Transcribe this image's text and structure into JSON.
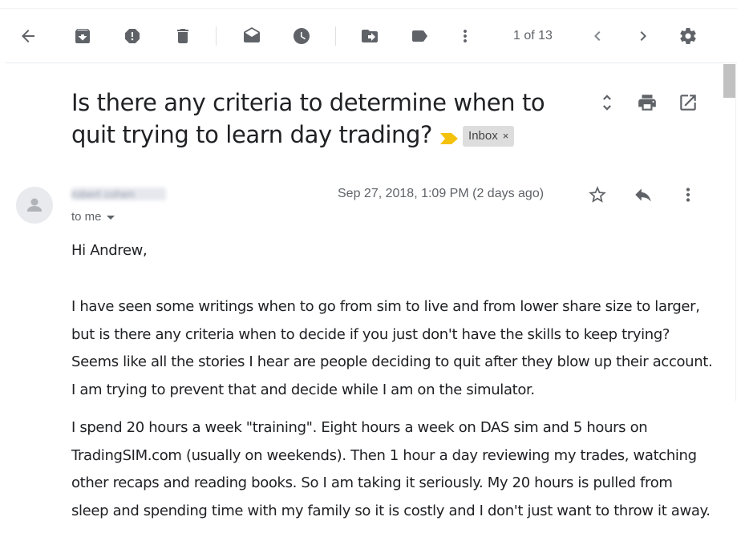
{
  "toolbar": {
    "icons": [
      "back-arrow-icon",
      "archive-icon",
      "report-spam-icon",
      "delete-icon",
      "mark-unread-icon",
      "snooze-icon",
      "move-to-icon",
      "label-icon",
      "more-vert-icon",
      "chevron-left-icon",
      "chevron-right-icon",
      "settings-gear-icon"
    ],
    "pager_text": "1 of 13"
  },
  "message": {
    "subject": "Is there any criteria to determine when to quit trying to learn day trading?",
    "label_chip": "Inbox",
    "label_chip_close": "×",
    "sender": "robert cohen",
    "recipient_text": "to me",
    "date": "Sep 27, 2018, 1:09 PM (2 days ago)"
  },
  "body": {
    "greeting": "Hi Andrew,",
    "paragraph1": "I have seen some writings when to go from sim to live and from lower share size to larger, but is there any criteria when to decide if you just don't have the skills to keep trying? Seems like all the stories I hear are people deciding to quit after they blow up their account. I am trying to prevent that and decide while I am on the simulator.",
    "paragraph2": "I spend 20 hours a week \"training\". Eight hours a week on DAS sim and 5 hours on TradingSIM.com (usually on weekends). Then 1 hour a day reviewing my trades, watching other recaps and reading books. So I am taking it seriously. My 20 hours is pulled from sleep and spending time with my family so it is costly and I don't just want to throw it away."
  },
  "colors": {
    "icon": "#5f6368",
    "important_marker": "#f4c20d",
    "chip_bg": "#dddddd",
    "text": "#202124"
  }
}
